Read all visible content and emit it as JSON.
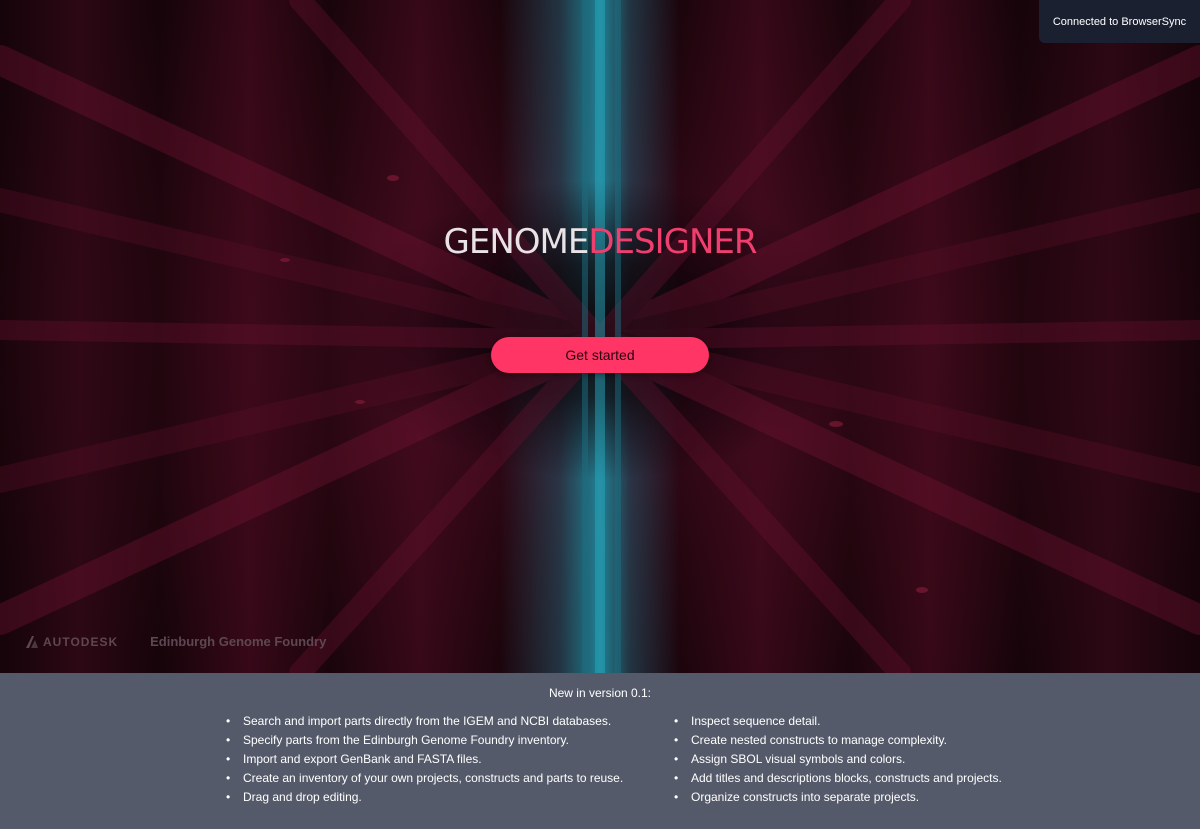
{
  "toast": {
    "text": "Connected to BrowserSync"
  },
  "hero": {
    "title_part1": "GENOME",
    "title_part2": "DESIGNER",
    "cta_label": "Get started",
    "title_colors": {
      "part1": "#e9e3e6",
      "part2": "#ef3f6e"
    },
    "cta_color": "#ff3565"
  },
  "partners": {
    "autodesk": "AUTODESK",
    "egf": "Edinburgh Genome Foundry"
  },
  "footer": {
    "heading": "New in version 0.1:",
    "features_left": [
      "Search and import parts directly from the IGEM and NCBI databases.",
      "Specify parts from the Edinburgh Genome Foundry inventory.",
      "Import and export GenBank and FASTA files.",
      "Create an inventory of your own projects, constructs and parts to reuse.",
      "Drag and drop editing."
    ],
    "features_right": [
      "Inspect sequence detail.",
      "Create nested constructs to manage complexity.",
      "Assign SBOL visual symbols and colors.",
      "Add titles and descriptions blocks, constructs and projects.",
      "Organize constructs into separate projects."
    ]
  }
}
